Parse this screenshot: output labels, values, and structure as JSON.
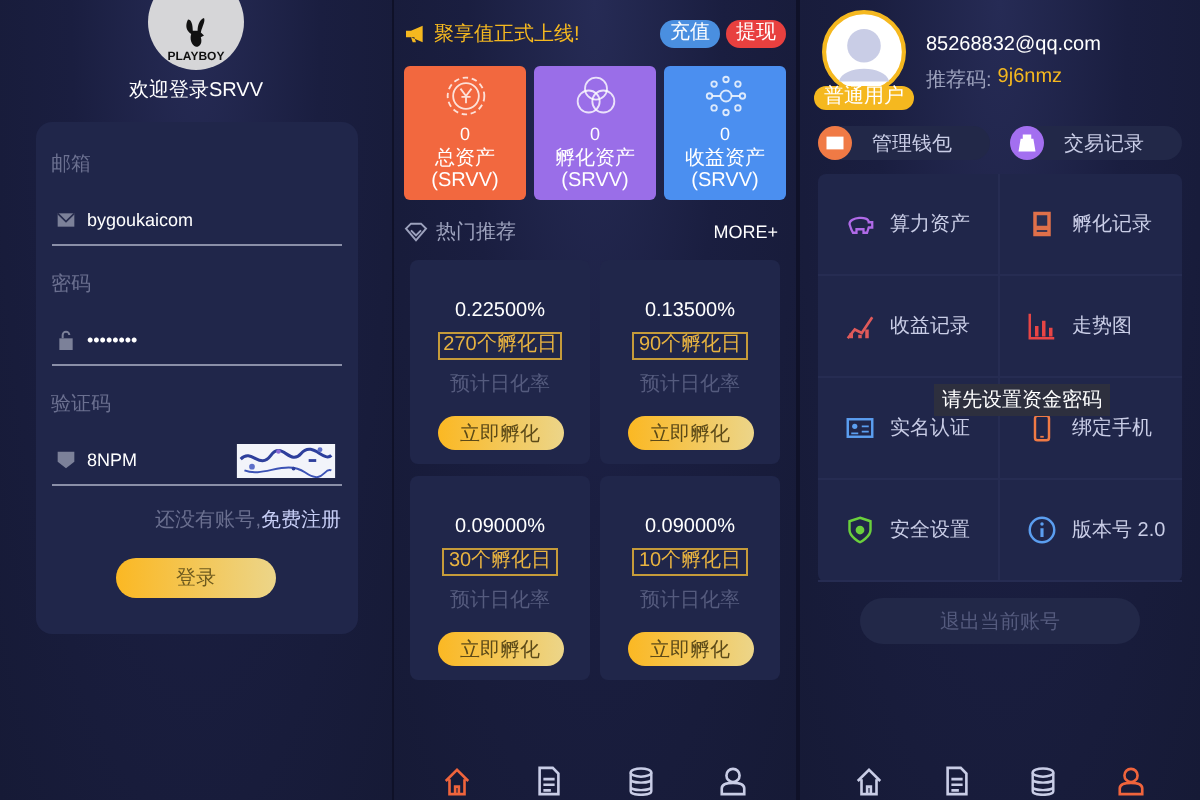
{
  "login": {
    "logo_text": "PLAYBOY",
    "title": "欢迎登录SRVV",
    "fields": [
      {
        "kind": "email",
        "label": "邮箱",
        "value": "bygoukaicom"
      },
      {
        "kind": "password",
        "label": "密码",
        "value": "••••••••"
      },
      {
        "kind": "captcha",
        "label": "验证码",
        "value": "8NPM"
      }
    ],
    "register_prompt": "还没有账号,",
    "register_link": "免费注册",
    "login_button": "登录"
  },
  "home": {
    "notice": "聚享值正式上线!",
    "actions": [
      {
        "label": "充值",
        "color": "#4a8fe0"
      },
      {
        "label": "提现",
        "color": "#e8403f"
      }
    ],
    "assets": [
      {
        "kind": "coin",
        "value": "0",
        "label": "总资产(SRVV)",
        "color": "#f2683f"
      },
      {
        "kind": "rings",
        "value": "0",
        "label": "孵化资产(SRVV)",
        "color": "#9a6ee8"
      },
      {
        "kind": "network",
        "value": "0",
        "label": "收益资产(SRVV)",
        "color": "#4b8ff0"
      }
    ],
    "section_title": "热门推荐",
    "more": "MORE+",
    "products": [
      {
        "rate": "0.22500%",
        "days": "270个孵化日",
        "caption": "预计日化率",
        "button": "立即孵化"
      },
      {
        "rate": "0.13500%",
        "days": "90个孵化日",
        "caption": "预计日化率",
        "button": "立即孵化"
      },
      {
        "rate": "0.09000%",
        "days": "30个孵化日",
        "caption": "预计日化率",
        "button": "立即孵化"
      },
      {
        "rate": "0.09000%",
        "days": "10个孵化日",
        "caption": "预计日化率",
        "button": "立即孵化"
      }
    ],
    "nav": [
      {
        "kind": "home",
        "selected": true
      },
      {
        "kind": "document",
        "selected": false
      },
      {
        "kind": "coins",
        "selected": false
      },
      {
        "kind": "user",
        "selected": false
      }
    ]
  },
  "profile": {
    "badge": "普通用户",
    "email": "85268832@qq.com",
    "referral_label": "推荐码:",
    "referral_code": "9j6nmz",
    "shortcuts": [
      {
        "kind": "wallet",
        "label": "管理钱包"
      },
      {
        "kind": "bag",
        "label": "交易记录"
      }
    ],
    "menu": [
      {
        "kind": "piggy",
        "label": "算力资产"
      },
      {
        "kind": "record",
        "label": "孵化记录"
      },
      {
        "kind": "growth",
        "label": "收益记录"
      },
      {
        "kind": "bars",
        "label": "走势图"
      },
      {
        "kind": "idcard",
        "label": "实名认证"
      },
      {
        "kind": "phone",
        "label": "绑定手机"
      },
      {
        "kind": "shield",
        "label": "安全设置"
      },
      {
        "kind": "info",
        "label": "版本号 2.0"
      }
    ],
    "tooltip": "请先设置资金密码",
    "logout": "退出当前账号",
    "nav": [
      {
        "kind": "home",
        "selected": false
      },
      {
        "kind": "document",
        "selected": false
      },
      {
        "kind": "coins",
        "selected": false
      },
      {
        "kind": "user",
        "selected": true
      }
    ]
  }
}
